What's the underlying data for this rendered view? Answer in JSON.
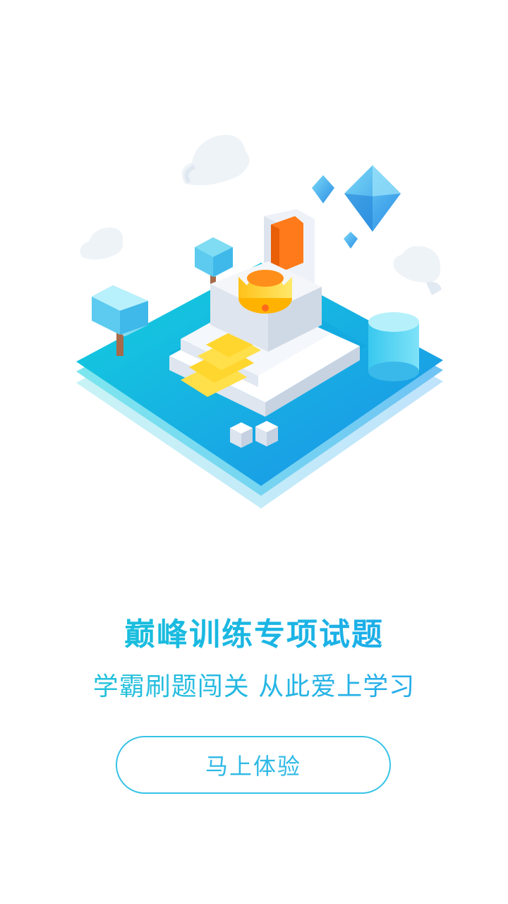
{
  "intro": {
    "headline": "巅峰训练专项试题",
    "subline": "学霸刷题闯关  从此爱上学习",
    "cta_label": "马上体验"
  },
  "illustration": {
    "subject": "isometric-throne-platform",
    "elements": [
      "cloud",
      "tree",
      "diamond",
      "throne",
      "crown",
      "stairs",
      "cube",
      "cylinder"
    ]
  },
  "colors": {
    "accent": "#1eb4e6",
    "accent_end": "#1ea6ee",
    "platform_top": "#1bb8e6",
    "throne_accent": "#ff7a1a",
    "stairs": "#ffd62e",
    "background": "#ffffff"
  }
}
